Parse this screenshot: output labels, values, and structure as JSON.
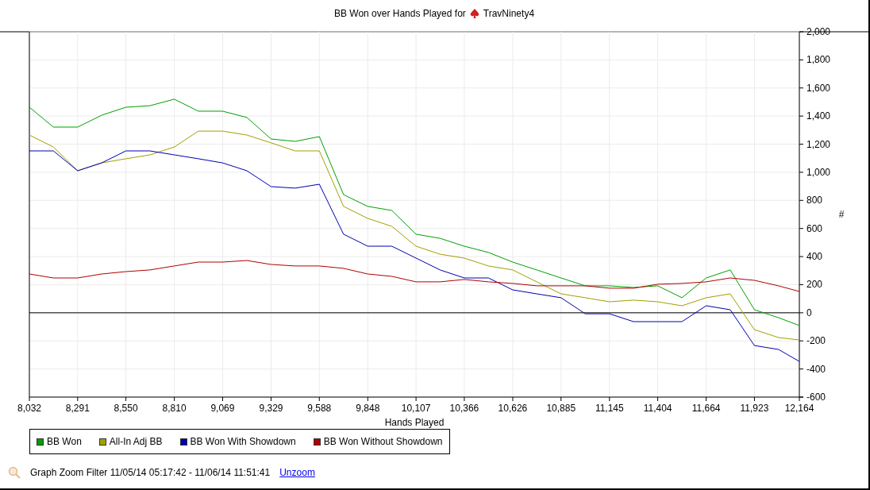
{
  "title": {
    "text": "BB Won over Hands Played for",
    "player": "TravNinety4"
  },
  "chart_data": {
    "type": "line",
    "grid": true,
    "xlabel": "Hands Played",
    "ylabel": "#",
    "x": [
      8032,
      8161,
      8291,
      8420,
      8550,
      8679,
      8810,
      8939,
      9069,
      9199,
      9329,
      9458,
      9588,
      9718,
      9848,
      9977,
      10107,
      10236,
      10366,
      10496,
      10626,
      10755,
      10885,
      11015,
      11145,
      11274,
      11404,
      11534,
      11664,
      11793,
      11923,
      12052,
      12164
    ],
    "xlim": [
      8032,
      12164
    ],
    "ylim": [
      -600,
      2000
    ],
    "xticks": [
      {
        "value": 8032,
        "label": "8,032"
      },
      {
        "value": 8291,
        "label": "8,291"
      },
      {
        "value": 8550,
        "label": "8,550"
      },
      {
        "value": 8810,
        "label": "8,810"
      },
      {
        "value": 9069,
        "label": "9,069"
      },
      {
        "value": 9329,
        "label": "9,329"
      },
      {
        "value": 9588,
        "label": "9,588"
      },
      {
        "value": 9848,
        "label": "9,848"
      },
      {
        "value": 10107,
        "label": "10,107"
      },
      {
        "value": 10366,
        "label": "10,366"
      },
      {
        "value": 10626,
        "label": "10,626"
      },
      {
        "value": 10885,
        "label": "10,885"
      },
      {
        "value": 11145,
        "label": "11,145"
      },
      {
        "value": 11404,
        "label": "11,404"
      },
      {
        "value": 11664,
        "label": "11,664"
      },
      {
        "value": 11923,
        "label": "11,923"
      },
      {
        "value": 12164,
        "label": "12,164"
      }
    ],
    "yticks": [
      {
        "value": 2000,
        "label": "2,000"
      },
      {
        "value": 1800,
        "label": "1,800"
      },
      {
        "value": 1600,
        "label": "1,600"
      },
      {
        "value": 1400,
        "label": "1,400"
      },
      {
        "value": 1200,
        "label": "1,200"
      },
      {
        "value": 1000,
        "label": "1,000"
      },
      {
        "value": 800,
        "label": "800"
      },
      {
        "value": 600,
        "label": "600"
      },
      {
        "value": 400,
        "label": "400"
      },
      {
        "value": 200,
        "label": "200"
      },
      {
        "value": 0,
        "label": "0"
      },
      {
        "value": -200,
        "label": "-200"
      },
      {
        "value": -400,
        "label": "-400"
      },
      {
        "value": -600,
        "label": "-600"
      }
    ],
    "series": [
      {
        "name": "BB Won",
        "color": "#00a000",
        "values": [
          1463,
          1322,
          1322,
          1406,
          1463,
          1474,
          1520,
          1435,
          1435,
          1390,
          1237,
          1220,
          1254,
          841,
          757,
          728,
          559,
          530,
          474,
          429,
          361,
          305,
          248,
          192,
          192,
          180,
          192,
          107,
          248,
          305,
          22,
          -35,
          -91
        ]
      },
      {
        "name": "All-In Adj BB",
        "color": "#a0a000",
        "values": [
          1265,
          1180,
          1011,
          1067,
          1096,
          1124,
          1180,
          1293,
          1293,
          1265,
          1209,
          1152,
          1152,
          757,
          672,
          615,
          474,
          417,
          389,
          333,
          305,
          220,
          135,
          107,
          78,
          90,
          78,
          50,
          107,
          135,
          -120,
          -176,
          -193
        ]
      },
      {
        "name": "BB Won With Showdown",
        "color": "#0000b0",
        "values": [
          1152,
          1152,
          1011,
          1067,
          1152,
          1152,
          1124,
          1096,
          1067,
          1011,
          898,
          887,
          915,
          559,
          474,
          474,
          389,
          305,
          248,
          248,
          163,
          135,
          107,
          -7,
          -7,
          -63,
          -63,
          -63,
          50,
          22,
          -233,
          -261,
          -346
        ]
      },
      {
        "name": "BB Won Without Showdown",
        "color": "#b00000",
        "values": [
          276,
          248,
          248,
          276,
          293,
          305,
          333,
          361,
          361,
          372,
          344,
          333,
          333,
          316,
          276,
          259,
          220,
          220,
          237,
          220,
          209,
          192,
          192,
          192,
          175,
          175,
          203,
          209,
          220,
          248,
          231,
          192,
          152
        ]
      }
    ]
  },
  "footer": {
    "label": "Graph Zoom Filter 11/05/14 05:17:42 - 11/06/14 11:51:41",
    "link": "Unzoom"
  }
}
